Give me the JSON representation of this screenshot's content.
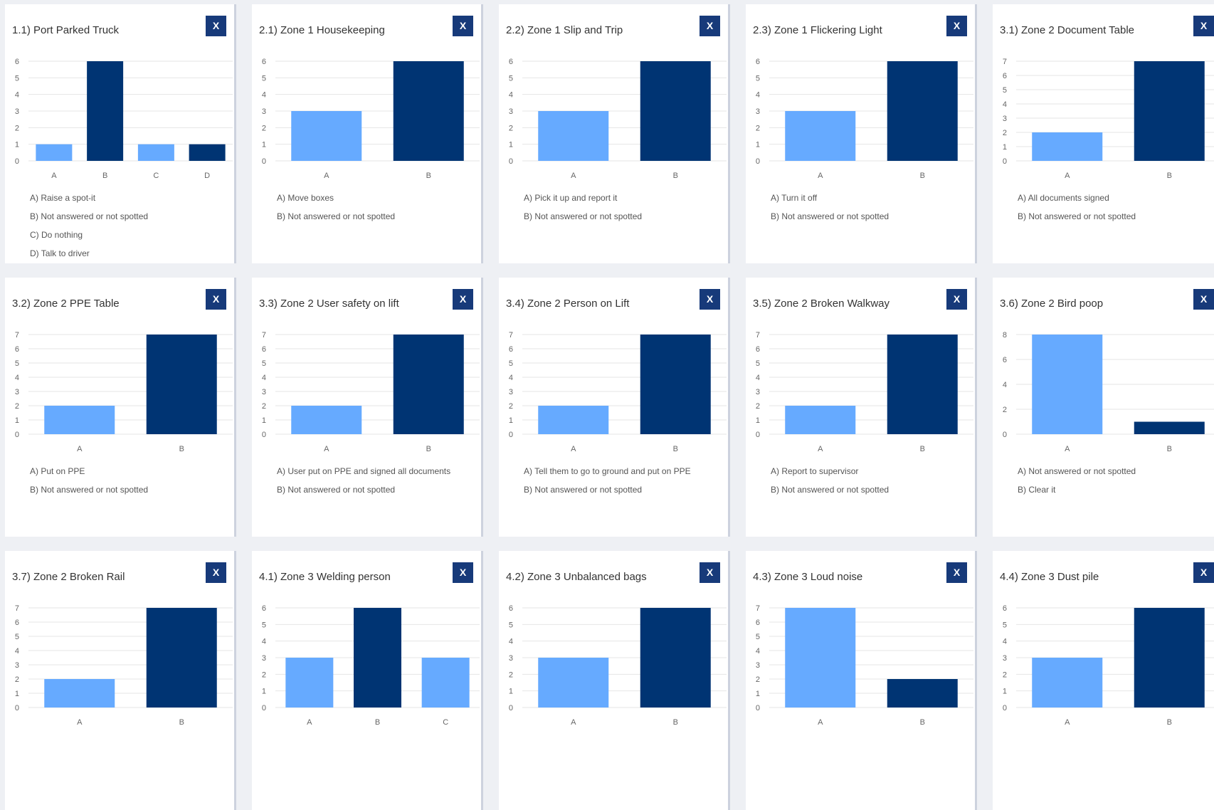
{
  "close_label": "X",
  "colors": {
    "light_bar": "#66aaff",
    "dark_bar": "#003473",
    "close_bg": "#173a7a",
    "page_bg": "#eef0f4",
    "grid": "#e6e6e6"
  },
  "cards": [
    {
      "title": "1.1) Port Parked Truck",
      "options": [
        "A) Raise a spot-it",
        "B) Not answered or not spotted",
        "C) Do nothing",
        "D) Talk to driver"
      ],
      "chart_data": {
        "type": "bar",
        "categories": [
          "A",
          "B",
          "C",
          "D"
        ],
        "values": [
          1,
          6,
          1,
          1
        ],
        "ylim": [
          0,
          6
        ],
        "yticks": [
          0,
          1,
          2,
          3,
          4,
          5,
          6
        ],
        "bar_colors": [
          "light",
          "dark",
          "light",
          "dark"
        ]
      }
    },
    {
      "title": "2.1) Zone 1 Housekeeping",
      "options": [
        "A) Move boxes",
        "B) Not answered or not spotted"
      ],
      "chart_data": {
        "type": "bar",
        "categories": [
          "A",
          "B"
        ],
        "values": [
          3,
          6
        ],
        "ylim": [
          0,
          6
        ],
        "yticks": [
          0,
          1,
          2,
          3,
          4,
          5,
          6
        ],
        "bar_colors": [
          "light",
          "dark"
        ]
      }
    },
    {
      "title": "2.2) Zone 1 Slip and Trip",
      "options": [
        "A) Pick it up and report it",
        "B) Not answered or not spotted"
      ],
      "chart_data": {
        "type": "bar",
        "categories": [
          "A",
          "B"
        ],
        "values": [
          3,
          6
        ],
        "ylim": [
          0,
          6
        ],
        "yticks": [
          0,
          1,
          2,
          3,
          4,
          5,
          6
        ],
        "bar_colors": [
          "light",
          "dark"
        ]
      }
    },
    {
      "title": "2.3) Zone 1 Flickering Light",
      "options": [
        "A) Turn it off",
        "B) Not answered or not spotted"
      ],
      "chart_data": {
        "type": "bar",
        "categories": [
          "A",
          "B"
        ],
        "values": [
          3,
          6
        ],
        "ylim": [
          0,
          6
        ],
        "yticks": [
          0,
          1,
          2,
          3,
          4,
          5,
          6
        ],
        "bar_colors": [
          "light",
          "dark"
        ]
      }
    },
    {
      "title": "3.1) Zone 2 Document Table",
      "options": [
        "A) All documents signed",
        "B) Not answered or not spotted"
      ],
      "chart_data": {
        "type": "bar",
        "categories": [
          "A",
          "B"
        ],
        "values": [
          2,
          7
        ],
        "ylim": [
          0,
          7
        ],
        "yticks": [
          0,
          1,
          2,
          3,
          4,
          5,
          6,
          7
        ],
        "bar_colors": [
          "light",
          "dark"
        ]
      }
    },
    {
      "title": "3.2) Zone 2 PPE Table",
      "options": [
        "A) Put on PPE",
        "B) Not answered or not spotted"
      ],
      "chart_data": {
        "type": "bar",
        "categories": [
          "A",
          "B"
        ],
        "values": [
          2,
          7
        ],
        "ylim": [
          0,
          7
        ],
        "yticks": [
          0,
          1,
          2,
          3,
          4,
          5,
          6,
          7
        ],
        "bar_colors": [
          "light",
          "dark"
        ]
      }
    },
    {
      "title": "3.3) Zone 2 User safety on lift",
      "options": [
        "A) User put on PPE and signed all documents",
        "B) Not answered or not spotted"
      ],
      "chart_data": {
        "type": "bar",
        "categories": [
          "A",
          "B"
        ],
        "values": [
          2,
          7
        ],
        "ylim": [
          0,
          7
        ],
        "yticks": [
          0,
          1,
          2,
          3,
          4,
          5,
          6,
          7
        ],
        "bar_colors": [
          "light",
          "dark"
        ]
      }
    },
    {
      "title": "3.4) Zone 2 Person on Lift",
      "options": [
        "A) Tell them to go to ground and put on PPE",
        "B) Not answered or not spotted"
      ],
      "chart_data": {
        "type": "bar",
        "categories": [
          "A",
          "B"
        ],
        "values": [
          2,
          7
        ],
        "ylim": [
          0,
          7
        ],
        "yticks": [
          0,
          1,
          2,
          3,
          4,
          5,
          6,
          7
        ],
        "bar_colors": [
          "light",
          "dark"
        ]
      }
    },
    {
      "title": "3.5) Zone 2 Broken Walkway",
      "options": [
        "A) Report to supervisor",
        "B) Not answered or not spotted"
      ],
      "chart_data": {
        "type": "bar",
        "categories": [
          "A",
          "B"
        ],
        "values": [
          2,
          7
        ],
        "ylim": [
          0,
          7
        ],
        "yticks": [
          0,
          1,
          2,
          3,
          4,
          5,
          6,
          7
        ],
        "bar_colors": [
          "light",
          "dark"
        ]
      }
    },
    {
      "title": "3.6) Zone 2 Bird poop",
      "options": [
        "A) Not answered or not spotted",
        "B) Clear it"
      ],
      "chart_data": {
        "type": "bar",
        "categories": [
          "A",
          "B"
        ],
        "values": [
          8,
          1
        ],
        "ylim": [
          0,
          8
        ],
        "yticks": [
          0,
          2,
          4,
          6,
          8
        ],
        "bar_colors": [
          "light",
          "dark"
        ]
      }
    },
    {
      "title": "3.7) Zone 2 Broken Rail",
      "options": [],
      "chart_data": {
        "type": "bar",
        "categories": [
          "A",
          "B"
        ],
        "values": [
          2,
          7
        ],
        "ylim": [
          0,
          7
        ],
        "yticks": [
          0,
          1,
          2,
          3,
          4,
          5,
          6,
          7
        ],
        "bar_colors": [
          "light",
          "dark"
        ]
      }
    },
    {
      "title": "4.1) Zone 3 Welding person",
      "options": [],
      "chart_data": {
        "type": "bar",
        "categories": [
          "A",
          "B",
          "C"
        ],
        "values": [
          3,
          6,
          3
        ],
        "ylim": [
          0,
          6
        ],
        "yticks": [
          0,
          1,
          2,
          3,
          4,
          5,
          6
        ],
        "bar_colors": [
          "light",
          "dark",
          "light"
        ]
      }
    },
    {
      "title": "4.2) Zone 3 Unbalanced bags",
      "options": [],
      "chart_data": {
        "type": "bar",
        "categories": [
          "A",
          "B"
        ],
        "values": [
          3,
          6
        ],
        "ylim": [
          0,
          6
        ],
        "yticks": [
          0,
          1,
          2,
          3,
          4,
          5,
          6
        ],
        "bar_colors": [
          "light",
          "dark"
        ]
      }
    },
    {
      "title": "4.3) Zone 3 Loud noise",
      "options": [],
      "chart_data": {
        "type": "bar",
        "categories": [
          "A",
          "B"
        ],
        "values": [
          7,
          2
        ],
        "ylim": [
          0,
          7
        ],
        "yticks": [
          0,
          1,
          2,
          3,
          4,
          5,
          6,
          7
        ],
        "bar_colors": [
          "light",
          "dark"
        ]
      }
    },
    {
      "title": "4.4) Zone 3 Dust pile",
      "options": [],
      "chart_data": {
        "type": "bar",
        "categories": [
          "A",
          "B"
        ],
        "values": [
          3,
          6
        ],
        "ylim": [
          0,
          6
        ],
        "yticks": [
          0,
          1,
          2,
          3,
          4,
          5,
          6
        ],
        "bar_colors": [
          "light",
          "dark"
        ]
      }
    }
  ]
}
